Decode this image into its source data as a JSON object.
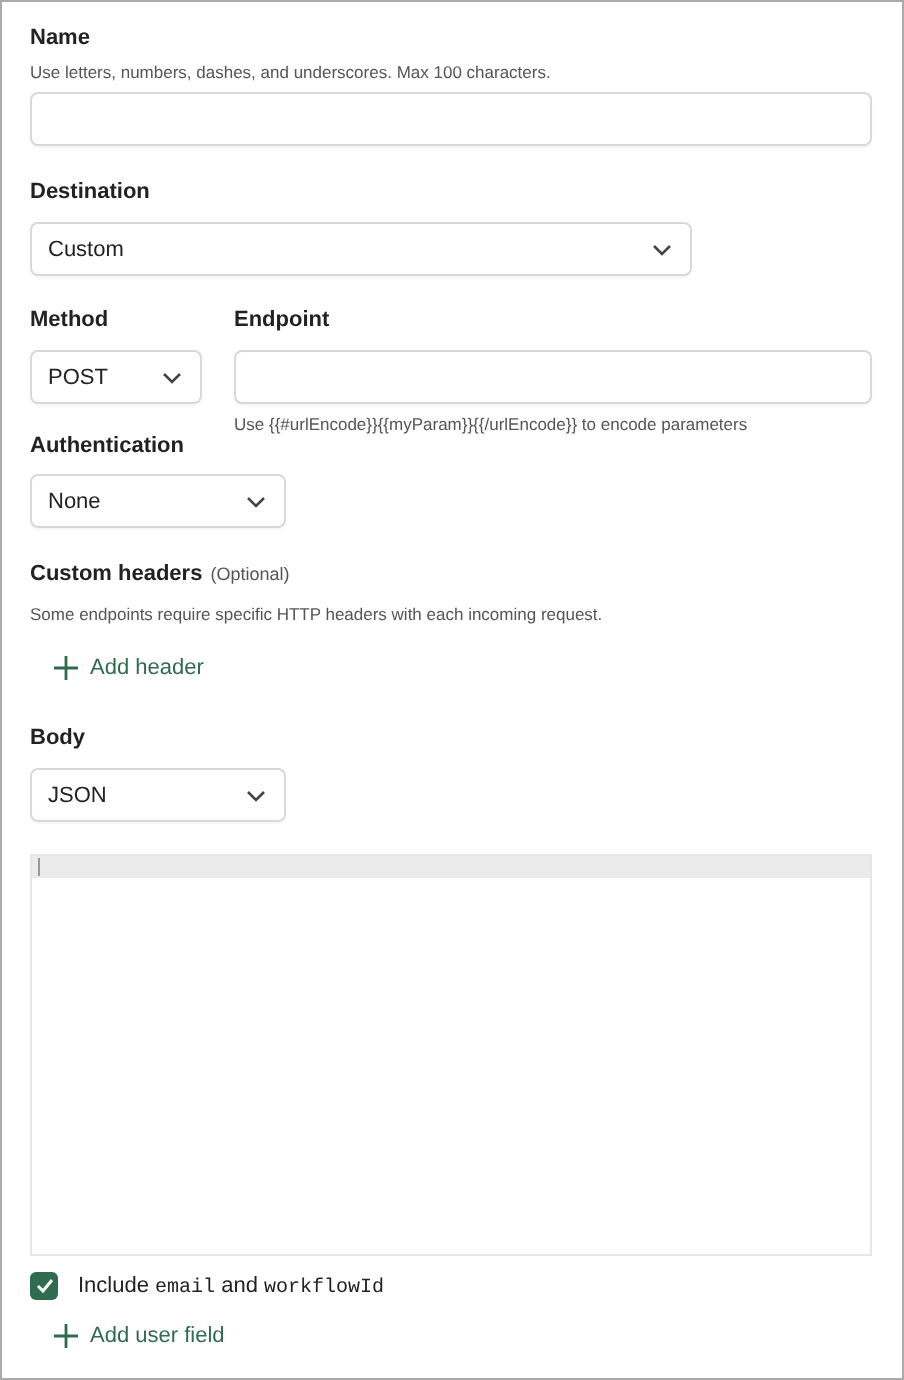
{
  "name_field": {
    "label": "Name",
    "hint": "Use letters, numbers, dashes, and underscores. Max 100 characters."
  },
  "destination": {
    "label": "Destination",
    "value": "Custom"
  },
  "method": {
    "label": "Method",
    "value": "POST"
  },
  "endpoint": {
    "label": "Endpoint",
    "hint": "Use {{#urlEncode}}{{myParam}}{{/urlEncode}} to encode parameters"
  },
  "authentication": {
    "label": "Authentication",
    "value": "None"
  },
  "custom_headers": {
    "label": "Custom headers",
    "optional": "(Optional)",
    "description": "Some endpoints require specific HTTP headers with each incoming request.",
    "add_button": "Add header"
  },
  "body": {
    "label": "Body",
    "value": "JSON"
  },
  "include_option": {
    "checked": true,
    "parts": [
      {
        "kind": "text",
        "text": "Include"
      },
      {
        "kind": "code",
        "text": "email"
      },
      {
        "kind": "text",
        "text": "and"
      },
      {
        "kind": "code",
        "text": "workflowId"
      }
    ]
  },
  "add_user_field": "Add user field"
}
